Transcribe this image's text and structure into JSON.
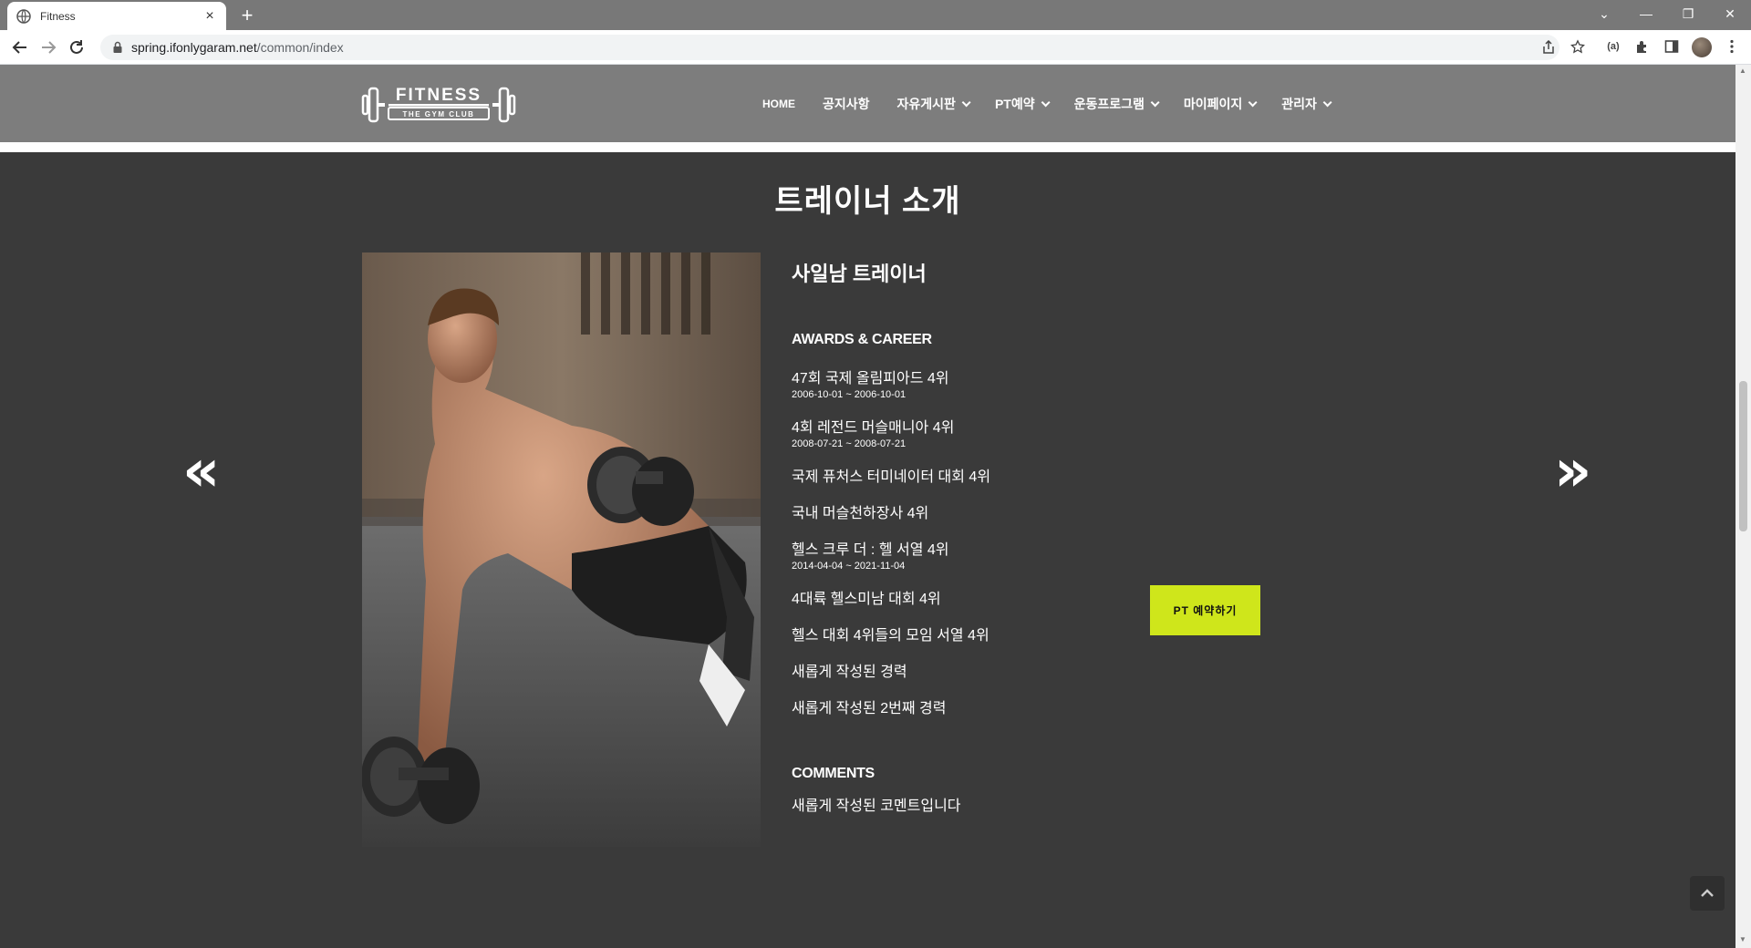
{
  "browser": {
    "tab_title": "Fitness",
    "new_tab_symbol": "+",
    "tab_close_symbol": "×",
    "url_host": "spring.ifonlygaram.net",
    "url_path": "/common/index",
    "window_controls": [
      "⌄",
      "—",
      "❐",
      "✕"
    ],
    "reader_icon_label": "(a)"
  },
  "site": {
    "logo_text": "FITNESS",
    "logo_subtext": "THE GYM CLUB",
    "menu": [
      {
        "label": "HOME",
        "has_dropdown": false
      },
      {
        "label": "공지사항",
        "has_dropdown": false
      },
      {
        "label": "자유게시판",
        "has_dropdown": true
      },
      {
        "label": "PT예약",
        "has_dropdown": true
      },
      {
        "label": "운동프로그램",
        "has_dropdown": true
      },
      {
        "label": "마이페이지",
        "has_dropdown": true
      },
      {
        "label": "관리자",
        "has_dropdown": true
      }
    ]
  },
  "section": {
    "title": "트레이너 소개",
    "prev_arrow": "«",
    "next_arrow": "»"
  },
  "trainer": {
    "name": "사일남 트레이너",
    "awards_heading": "AWARDS & CAREER",
    "careers": [
      {
        "title": "47회 국제 올림피아드 4위",
        "date": "2006-10-01 ~ 2006-10-01"
      },
      {
        "title": "4회 레전드 머슬매니아 4위",
        "date": "2008-07-21 ~ 2008-07-21"
      },
      {
        "title": "국제 퓨처스 터미네이터 대회 4위",
        "date": ""
      },
      {
        "title": "국내 머슬천하장사 4위",
        "date": ""
      },
      {
        "title": "헬스 크루 더 : 헬 서열 4위",
        "date": "2014-04-04 ~ 2021-11-04"
      },
      {
        "title": "4대륙 헬스미남 대회 4위",
        "date": ""
      },
      {
        "title": "헬스 대회 4위들의 모임 서열 4위",
        "date": ""
      },
      {
        "title": "새롭게 작성된 경력",
        "date": ""
      },
      {
        "title": "새롭게 작성된 2번째 경력",
        "date": ""
      }
    ],
    "comments_heading": "COMMENTS",
    "comment": "새롭게 작성된 코멘트입니다",
    "pt_button_label": "PT 예약하기"
  },
  "carousel": {
    "dot_count": 5,
    "active_index": 1
  },
  "colors": {
    "accent": "#cfe61b",
    "section_bg": "#3a3a3a",
    "header_bg": "#7d7d7d"
  }
}
